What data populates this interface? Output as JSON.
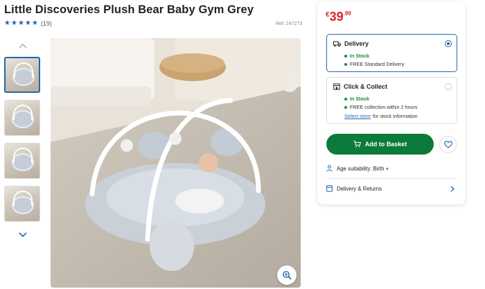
{
  "product": {
    "title": "Little Discoveries Plush Bear Baby Gym Grey",
    "rating_stars": 5,
    "review_count": "(19)",
    "ref": "Ref: 247273"
  },
  "gallery": {
    "thumbnails": [
      "thumbnail-1",
      "thumbnail-2",
      "thumbnail-3",
      "thumbnail-4"
    ],
    "active_index": 0,
    "up_icon": "chevron-up-icon",
    "down_icon": "chevron-down-icon",
    "zoom_icon": "zoom-in-icon"
  },
  "price": {
    "currency": "€",
    "whole": "39",
    "decimal": ".99"
  },
  "delivery": {
    "label": "Delivery",
    "stock": "In Stock",
    "detail": "FREE Standard Delivery",
    "selected": true
  },
  "collect": {
    "label": "Click & Collect",
    "stock": "In Stock",
    "detail": "FREE collection within 2 hours",
    "store_link": "Select store",
    "store_suffix": "for stock information",
    "selected": false
  },
  "actions": {
    "add_to_basket": "Add to Basket",
    "wishlist_icon": "heart-icon"
  },
  "info": {
    "age": "Age suitability: Birth +",
    "delivery_returns": "Delivery & Returns"
  },
  "colors": {
    "brand_blue": "#1f67b0",
    "price_red": "#d6232f",
    "basket_green": "#0b7a3a",
    "stock_green": "#1a8a3a"
  }
}
